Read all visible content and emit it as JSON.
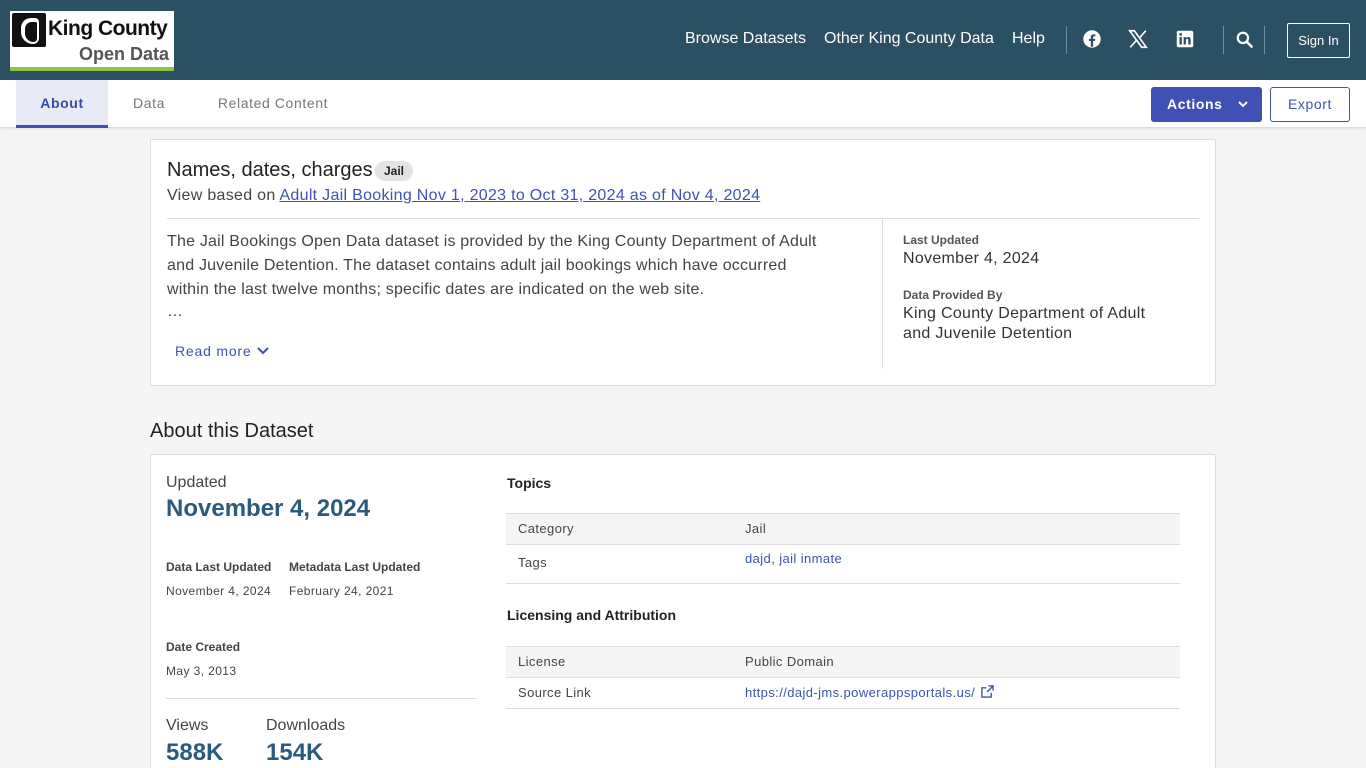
{
  "header": {
    "logo": {
      "line1": "King County",
      "line2": "Open Data"
    },
    "nav": [
      "Browse Datasets",
      "Other King County Data",
      "Help"
    ],
    "sign_in": "Sign In"
  },
  "tabs": {
    "about": "About",
    "data": "Data",
    "related": "Related Content"
  },
  "toolbar": {
    "actions": "Actions",
    "export": "Export"
  },
  "summary": {
    "title": "Names, dates, charges",
    "badge": "Jail",
    "view_prefix": "View based on",
    "view_link": "Adult Jail Booking Nov 1, 2023 to Oct 31, 2024 as of Nov 4, 2024",
    "description": "The Jail Bookings Open Data dataset is provided by the King County Department of Adult and Juvenile Detention. The dataset contains adult jail bookings which have occurred within the last twelve months; specific dates are indicated on the web site.",
    "ellipsis": "…",
    "read_more": "Read more",
    "last_updated_label": "Last Updated",
    "last_updated_value": "November 4, 2024",
    "provided_by_label": "Data Provided By",
    "provided_by_value": "King County Department of Adult and Juvenile Detention"
  },
  "about": {
    "section_title": "About this Dataset",
    "updated_label": "Updated",
    "updated_value": "November 4, 2024",
    "data_last_updated_label": "Data Last Updated",
    "data_last_updated_value": "November 4, 2024",
    "metadata_last_updated_label": "Metadata Last Updated",
    "metadata_last_updated_value": "February 24, 2021",
    "date_created_label": "Date Created",
    "date_created_value": "May 3, 2013",
    "views_label": "Views",
    "views_value": "588K",
    "downloads_label": "Downloads",
    "downloads_value": "154K",
    "topics_heading": "Topics",
    "category_key": "Category",
    "category_value": "Jail",
    "tags_key": "Tags",
    "tags": [
      "dajd",
      "jail inmate"
    ],
    "licensing_heading": "Licensing and Attribution",
    "license_key": "License",
    "license_value": "Public Domain",
    "source_key": "Source Link",
    "source_value": "https://dajd-jms.powerappsportals.us/"
  },
  "colors": {
    "header_bg": "#2b4f63",
    "accent": "#3f51b5",
    "stat": "#2b5b7c",
    "logo_bar": "#8dc63f"
  }
}
